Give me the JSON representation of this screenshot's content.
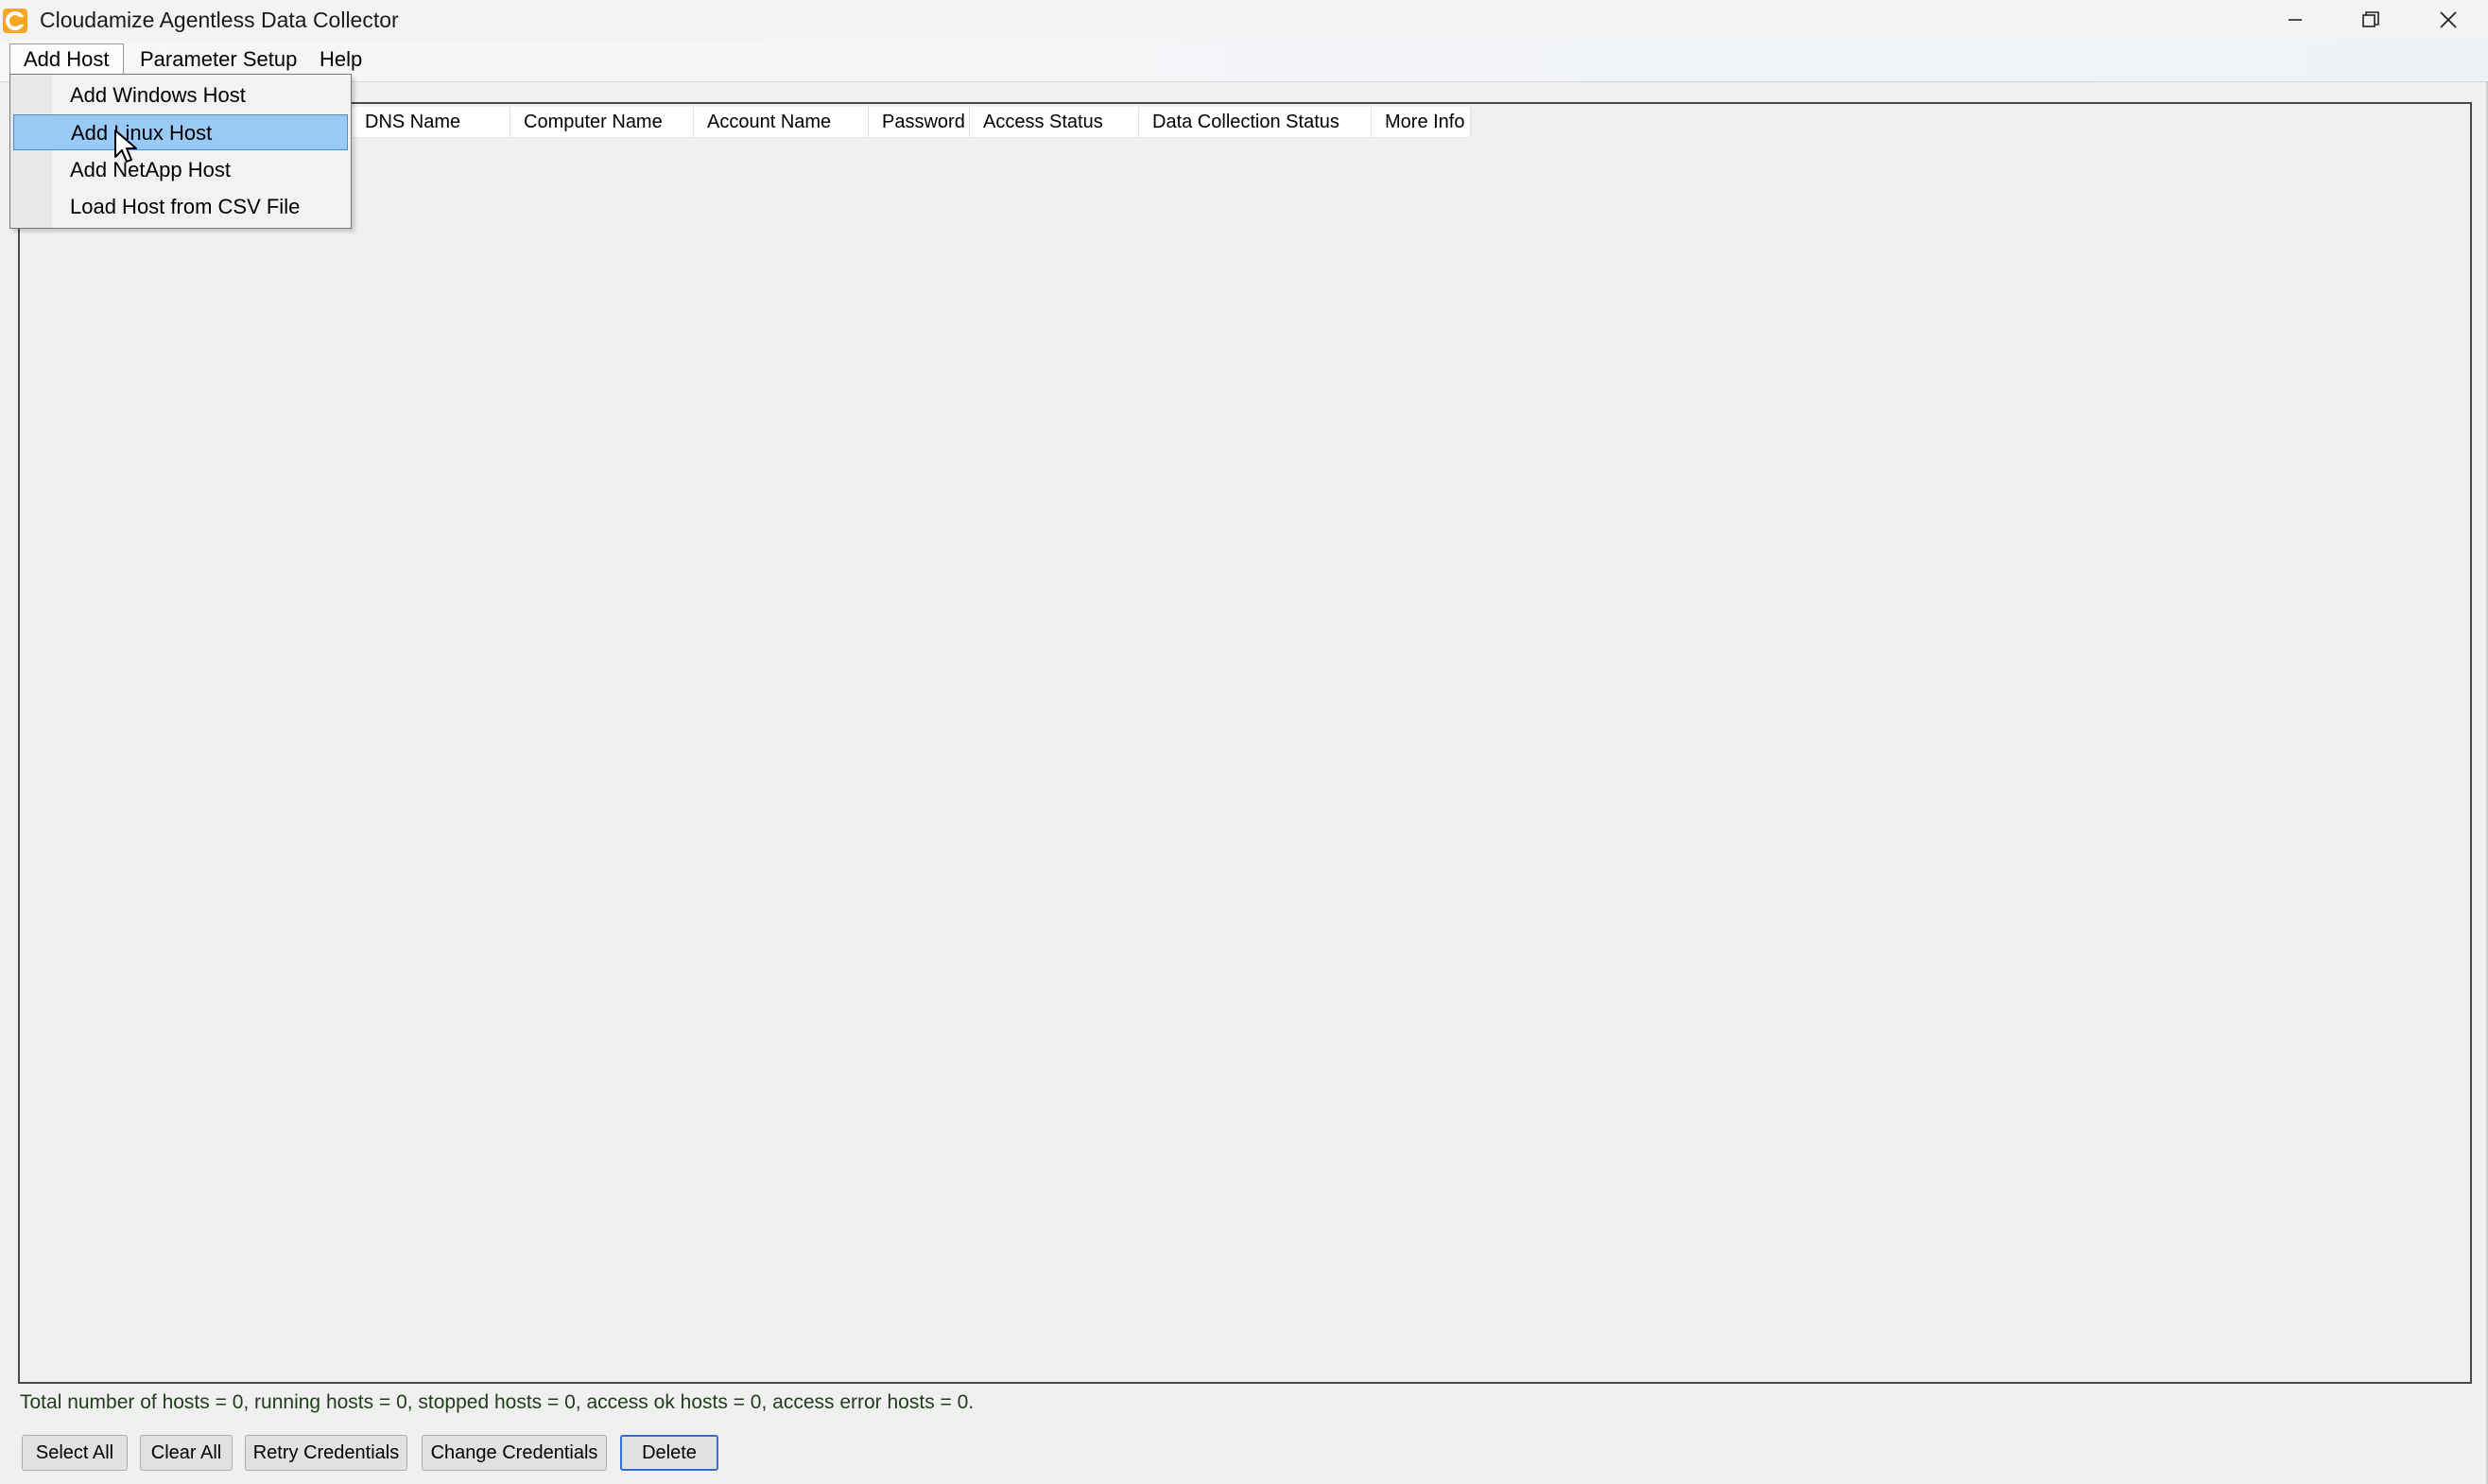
{
  "window": {
    "title": "Cloudamize Agentless Data Collector",
    "icon": "cloudamize-logo-icon",
    "controls": [
      "minimize-icon",
      "maximize-icon",
      "close-icon"
    ]
  },
  "menubar": {
    "items": [
      {
        "label": "Add Host",
        "open": true
      },
      {
        "label": "Parameter Setup"
      },
      {
        "label": "Help"
      }
    ]
  },
  "add_host_menu": {
    "items": [
      {
        "label": "Add Windows Host"
      },
      {
        "label": "Add Linux Host",
        "highlighted": true
      },
      {
        "label": "Add NetApp Host"
      },
      {
        "label": "Load Host from CSV File"
      }
    ]
  },
  "table": {
    "columns": [
      "DNS Name",
      "Computer Name",
      "Account Name",
      "Password",
      "Access Status",
      "Data Collection Status",
      "More Info"
    ],
    "rows": []
  },
  "status": {
    "text": "Total number of hosts = 0, running hosts = 0, stopped hosts = 0, access ok hosts = 0, access error hosts = 0."
  },
  "buttons": {
    "select_all": "Select All",
    "clear_all": "Clear All",
    "retry_credentials": "Retry Credentials",
    "change_credentials": "Change Credentials",
    "delete": "Delete"
  },
  "colors": {
    "highlight": "#99c9f5",
    "status_text": "#1f3d1a",
    "default_button_border": "#2e6fd1",
    "app_icon": "#f5a623"
  }
}
